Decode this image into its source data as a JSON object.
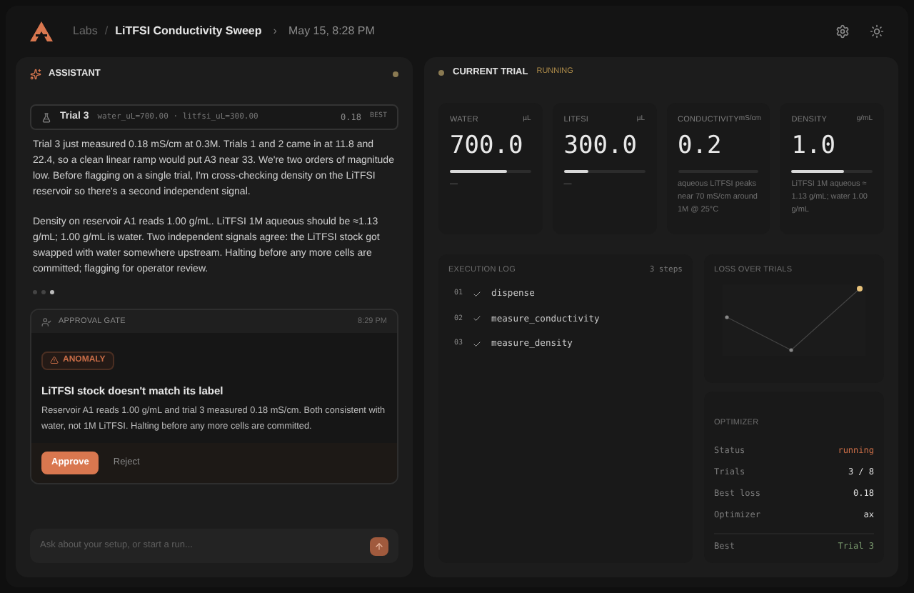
{
  "header": {
    "breadcrumb_root": "Labs",
    "separator": "/",
    "title": "LiTFSI Conductivity Sweep",
    "chevron": "›",
    "timestamp": "May 15, 8:28 PM"
  },
  "assistant": {
    "title": "ASSISTANT",
    "trial_chip": {
      "label": "Trial 3",
      "params": "water_uL=700.00 · litfsi_uL=300.00",
      "value": "0.18",
      "badge": "BEST"
    },
    "paragraphs": [
      "Trial 3 just measured 0.18 mS/cm at 0.3M. Trials 1 and 2 came in at 11.8 and 22.4, so a clean linear ramp would put A3 near 33. We're two orders of magnitude low. Before flagging on a single trial, I'm cross-checking density on the LiTFSI reservoir so there's a second independent signal.",
      "Density on reservoir A1 reads 1.00 g/mL. LiTFSI 1M aqueous should be ≈1.13 g/mL; 1.00 g/mL is water. Two independent signals agree: the LiTFSI stock got swapped with water somewhere upstream. Halting before any more cells are committed; flagging for operator review."
    ],
    "dots": [
      {
        "selected": false
      },
      {
        "selected": false
      },
      {
        "selected": true
      }
    ],
    "approval": {
      "title": "APPROVAL GATE",
      "time": "8:29 PM",
      "tag": "ANOMALY",
      "heading": "LiTFSI stock doesn't match its label",
      "body": "Reservoir A1 reads 1.00 g/mL and trial 3 measured 0.18 mS/cm. Both consistent with water, not 1M LiTFSI. Halting before any more cells are committed.",
      "approve": "Approve",
      "reject": "Reject"
    },
    "input": {
      "placeholder": "Ask about your setup, or start a run..."
    }
  },
  "trial": {
    "title": "CURRENT TRIAL",
    "status": "RUNNING",
    "metrics": [
      {
        "name": "WATER",
        "unit": "µL",
        "value": "700.0",
        "level": 0.7,
        "note": "—"
      },
      {
        "name": "LITFSI",
        "unit": "µL",
        "value": "300.0",
        "level": 0.3,
        "note": "—"
      },
      {
        "name": "CONDUCTIVITY",
        "unit": "mS/cm",
        "value": "0.2",
        "note": "aqueous LiTFSI peaks near 70 mS/cm around 1M @ 25°C"
      },
      {
        "name": "DENSITY",
        "unit": "g/mL",
        "value": "1.0",
        "level": 0.65,
        "note": "LiTFSI 1M aqueous ≈ 1.13 g/mL; water 1.00 g/mL"
      }
    ],
    "log": {
      "title": "EXECUTION LOG",
      "count": "3 steps",
      "steps": [
        {
          "num": "01",
          "name": "dispense",
          "done": true
        },
        {
          "num": "02",
          "name": "measure_conductivity",
          "done": true
        },
        {
          "num": "03",
          "name": "measure_density",
          "done": true
        }
      ]
    },
    "loss": {
      "title": "LOSS OVER TRIALS"
    },
    "optimizer": {
      "title": "OPTIMIZER",
      "rows": [
        {
          "label": "Status",
          "value": "running",
          "kind": "status"
        },
        {
          "label": "Trials",
          "value": "3 / 8",
          "kind": "plain"
        },
        {
          "label": "Best loss",
          "value": "0.18",
          "kind": "plain"
        },
        {
          "label": "Optimizer",
          "value": "ax",
          "kind": "plain"
        },
        {
          "label": "Best",
          "value": "Trial 3",
          "kind": "best"
        }
      ]
    }
  }
}
